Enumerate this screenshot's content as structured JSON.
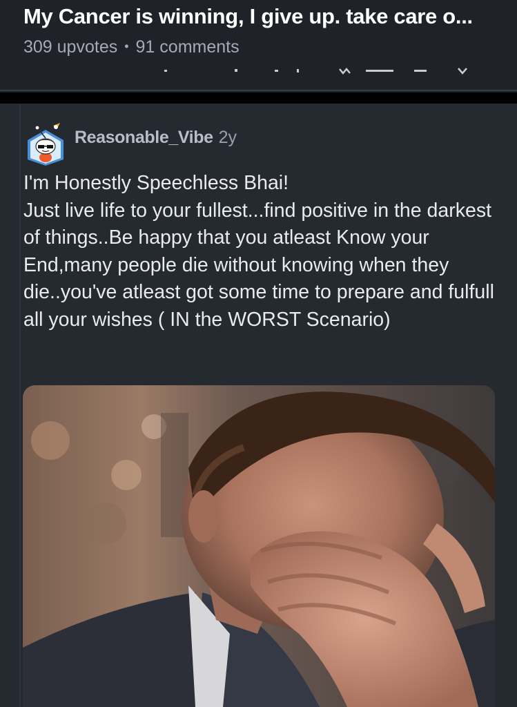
{
  "post": {
    "title": "My Cancer is winning, I give up. take care o...",
    "upvotes": "309 upvotes",
    "separator": "•",
    "comments": "91 comments"
  },
  "comment": {
    "author": "Reasonable_Vibe",
    "age": "2y",
    "body": "I'm Honestly Speechless Bhai!\nJust live life to your fullest...find positive in the darkest of things..Be happy that you atleast Know your End,many people die without knowing when they die..you've atleast got some time to prepare and fulfull all your wishes ( IN the WORST Scenario)",
    "avatar_icon": "snoo-avatar-with-sunglasses-icon",
    "media_icon": "crying-man-gif-image"
  },
  "colors": {
    "background": "#20242b",
    "title_text": "#ffffff",
    "meta_text": "#a6abb3",
    "body_text": "#e9ebee",
    "author_text": "#b8bec7"
  }
}
